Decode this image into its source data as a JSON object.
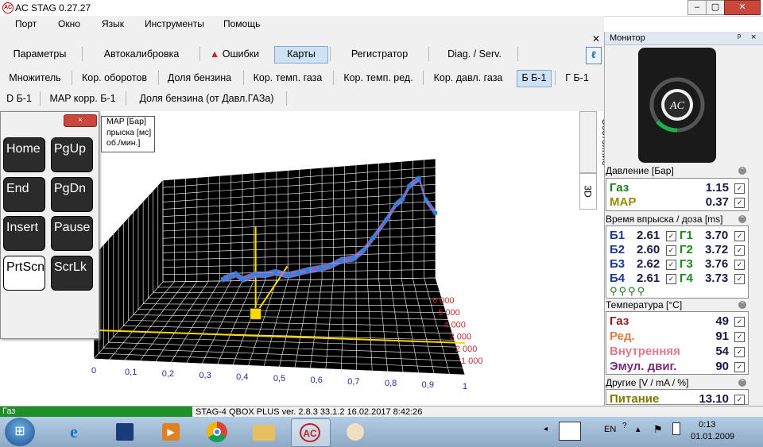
{
  "window": {
    "title": "AC STAG 0.27.27",
    "app_icon": "AC"
  },
  "menu": [
    "Порт",
    "Окно",
    "Язык",
    "Инструменты",
    "Помощь"
  ],
  "main_tabs": [
    {
      "label": "Параметры"
    },
    {
      "label": "Автокалибровка"
    },
    {
      "label": "Ошибки",
      "icon": "warning-icon"
    },
    {
      "label": "Карты",
      "active": true
    },
    {
      "label": "Регистратор"
    },
    {
      "label": "Diag. / Serv."
    }
  ],
  "sub_tabs_row1": [
    {
      "label": "Множитель"
    },
    {
      "label": "Кор. оборотов"
    },
    {
      "label": "Доля бензина"
    },
    {
      "label": "Кор. темп. газа"
    },
    {
      "label": "Кор. темп. ред."
    },
    {
      "label": "Кор. давл. газа"
    },
    {
      "label": "Б Б-1",
      "active": true
    },
    {
      "label": "Г Б-1"
    }
  ],
  "sub_tabs_row2": [
    {
      "label": "D Б-1"
    },
    {
      "label": "MAP корр. Б-1"
    },
    {
      "label": "Доля бензина (от Давл.ГАЗа)"
    }
  ],
  "side_tabs": {
    "state": "Состояние",
    "three_d": "3D"
  },
  "keypad": {
    "close": "×",
    "keys": [
      {
        "label": "Home"
      },
      {
        "label": "PgUp"
      },
      {
        "label": "End"
      },
      {
        "label": "PgDn"
      },
      {
        "label": "Insert"
      },
      {
        "label": "Pause"
      },
      {
        "label": "PrtScn",
        "style": "white"
      },
      {
        "label": "ScrLk"
      }
    ]
  },
  "legend": [
    "MAP [Бар]",
    "прыска [мс]",
    "об./мин.]"
  ],
  "chart_data": {
    "type": "scatter",
    "x_ticks": [
      "0",
      "0,1",
      "0,2",
      "0,3",
      "0,4",
      "0,5",
      "0,6",
      "0,7",
      "0,8",
      "0,9",
      "1"
    ],
    "depth_ticks": [
      "1 000",
      "2 000",
      "3 000",
      "4 000",
      "5 000",
      "6 000"
    ],
    "xlim": [
      0,
      1
    ],
    "depth_lim": [
      1000,
      6000
    ],
    "grid": true,
    "colors": {
      "wall": "#000000",
      "grid": "#ffffff",
      "points": "#1e88e5",
      "surface": "#8888ff",
      "crosshair": "#ffd800"
    },
    "series": [
      {
        "x": [
          0.3,
          0.32,
          0.34,
          0.36,
          0.4,
          0.43,
          0.46,
          0.5,
          0.53,
          0.56,
          0.6,
          0.63,
          0.66,
          0.7,
          0.73,
          0.76,
          0.8,
          0.83,
          0.85,
          0.87,
          0.9,
          0.92,
          0.95
        ],
        "y": [
          0.18,
          0.19,
          0.2,
          0.18,
          0.2,
          0.2,
          0.21,
          0.2,
          0.21,
          0.22,
          0.23,
          0.24,
          0.26,
          0.27,
          0.3,
          0.35,
          0.42,
          0.48,
          0.5,
          0.55,
          0.58,
          0.5,
          0.45
        ]
      }
    ]
  },
  "monitor": {
    "title": "Монитор",
    "pin": "ᵖ",
    "close": "×",
    "pressure": {
      "title": "Давление [Бар]",
      "rows": [
        {
          "label": "Газ",
          "value": "1.15",
          "color": "#1a7a1a"
        },
        {
          "label": "MAP",
          "value": "0.37",
          "color": "#9a8a00"
        }
      ]
    },
    "injection": {
      "title": "Время впрыска / доза [ms]",
      "rows": [
        {
          "b": "Б1",
          "bv": "2.61",
          "g": "Г1",
          "gv": "3.70"
        },
        {
          "b": "Б2",
          "bv": "2.60",
          "g": "Г2",
          "gv": "3.72"
        },
        {
          "b": "Б3",
          "bv": "2.62",
          "g": "Г3",
          "gv": "3.76"
        },
        {
          "b": "Б4",
          "bv": "2.61",
          "g": "Г4",
          "gv": "3.73"
        }
      ]
    },
    "temperature": {
      "title": "Температура [°C]",
      "rows": [
        {
          "label": "Газ",
          "value": "49",
          "color": "#8a1a1a"
        },
        {
          "label": "Ред.",
          "value": "91",
          "color": "#e07a3a"
        },
        {
          "label": "Внутренняя",
          "value": "54",
          "color": "#e07a8a"
        },
        {
          "label": "Эмул. двиг.",
          "value": "90",
          "color": "#7a2a7a"
        }
      ]
    },
    "other": {
      "title": "Другие [V / mA / %]",
      "rows": [
        {
          "label": "Питание",
          "value": "13.10",
          "color": "#7a7a00"
        }
      ]
    }
  },
  "status": {
    "gas": "Газ",
    "device": "STAG-4 QBOX PLUS  ver. 2.8.3  33.1.2  16.02.2017 8:42:26"
  },
  "taskbar": {
    "lang": "EN",
    "time": "0:13",
    "date": "01.01.2009"
  }
}
